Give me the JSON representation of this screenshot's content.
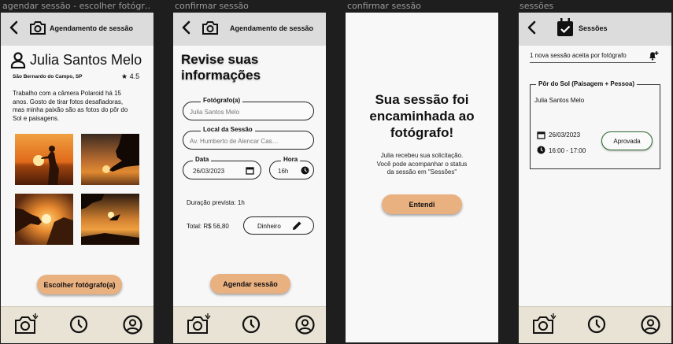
{
  "frame_labels": [
    "agendar sessão - escolher fotógr…",
    "confirmar sessão",
    "confirmar sessão",
    "sessões"
  ],
  "f1": {
    "title": "Agendamento de sessão",
    "photographer_name": "Julia Santos Melo",
    "location": "São Bernardo do Campo, SP",
    "rating": "4.5",
    "bio": [
      "Trabalho com a câmera Polaroid há 15",
      "anos. Gosto de tirar fotos desafiadoras,",
      "mas minha paixão são as fotos do pôr do",
      "Sol e paisagens."
    ],
    "choose_button": "Escolher fotógrafo(a)"
  },
  "f2": {
    "title": "Agendamento de sessão",
    "heading_line1": "Revise suas",
    "heading_line2": "informações",
    "photographer_label": "Fotógrafo(a)",
    "photographer_value": "Julia Santos Melo",
    "place_label": "Local da Sessão",
    "place_value": "Av. Humberto de Alencar Cas…",
    "date_label": "Data",
    "date_value": "26/03/2023",
    "time_label": "Hora",
    "time_value": "16h",
    "duration": "Duração prevista: 1h",
    "total": "Total: R$ 56,80",
    "payment": "Dinheiro",
    "schedule_button": "Agendar sessão"
  },
  "f3": {
    "heading": [
      "Sua sessão foi",
      "encaminhada ao",
      "fotógrafo!"
    ],
    "message": [
      "Julia recebeu sua solicitação.",
      "Você pode acompanhar o status",
      "da sessão em \"Sessões\""
    ],
    "ok_button": "Entendi"
  },
  "f4": {
    "title": "Sessões",
    "notification": "1 nova sessão aceita por fotógrafo",
    "card_title": "Pôr do Sol (Paisagem + Pessoa)",
    "card_name": "Julia Santos Melo",
    "card_date": "26/03/2023",
    "card_time": "16:00 - 17:00",
    "status": "Aprovada",
    "status_color": "#2e6b2e"
  },
  "colors": {
    "header": "#dcdcdc",
    "nav": "#e9e3d5",
    "button": "#e9b080"
  }
}
